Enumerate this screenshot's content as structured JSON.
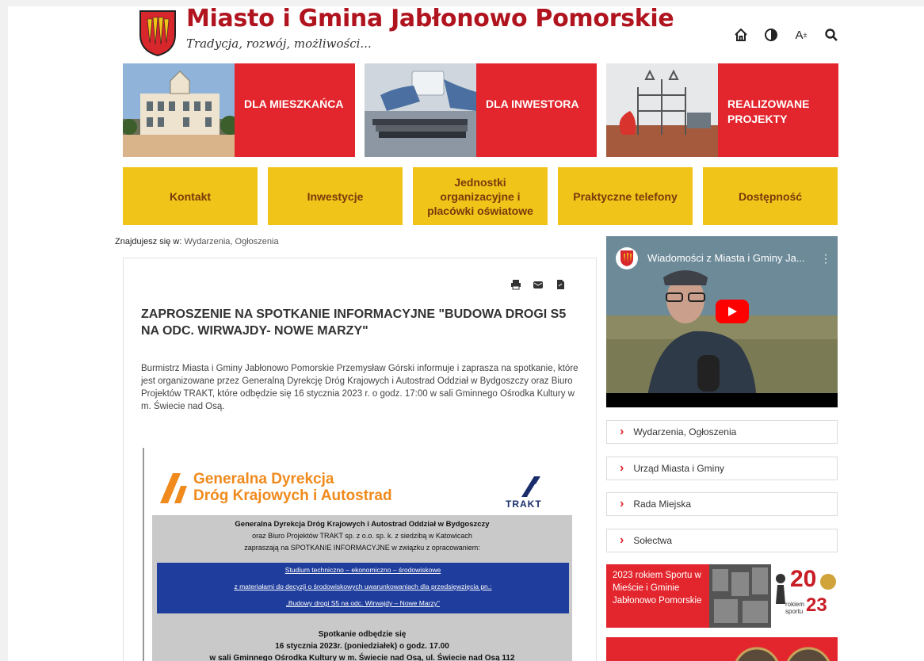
{
  "header": {
    "title": "Miasto i Gmina Jabłonowo Pomorskie",
    "subtitle": "Tradycja, rozwój, możliwości..."
  },
  "toolbar": {
    "icons": [
      "home-icon",
      "contrast-icon",
      "font-size-icon",
      "search-icon"
    ],
    "font_label": "A"
  },
  "tiles": [
    {
      "label": "DLA MIESZKAŃCA"
    },
    {
      "label": "DLA INWESTORA"
    },
    {
      "label": "REALIZOWANE PROJEKTY"
    }
  ],
  "nav": [
    {
      "label": "Kontakt"
    },
    {
      "label": "Inwestycje"
    },
    {
      "label": "Jednostki organizacyjne i placówki oświatowe"
    },
    {
      "label": "Praktyczne telefony"
    },
    {
      "label": "Dostępność"
    }
  ],
  "breadcrumb": {
    "prefix": "Znajdujesz się w:",
    "path": "Wydarzenia, Ogłoszenia"
  },
  "article": {
    "title": "ZAPROSZENIE NA SPOTKANIE INFORMACYJNE \"BUDOWA DROGI S5 NA ODC. WIRWAJDY- NOWE MARZY\"",
    "body": "Burmistrz Miasta i Gminy Jabłonowo Pomorskie Przemysław Górski informuje i zaprasza na spotkanie, które jest organizowane przez Generalną Dyrekcję Dróg Krajowych i Autostrad Oddział w Bydgoszczy oraz Biuro Projektów TRAKT, które odbędzie się 16 stycznia 2023 r. o godz. 17:00 w sali Gminnego Ośrodka Kultury w m. Świecie nad Osą."
  },
  "poster": {
    "org_line1": "Generalna Dyrekcja",
    "org_line2": "Dróg Krajowych i Autostrad",
    "trakt": "TRAKT",
    "line1": "Generalna Dyrekcja Dróg Krajowych i Autostrad  Oddział w Bydgoszczy",
    "line2": "oraz Biuro Projektów TRAKT sp. z o.o. sp. k. z siedzibą w Katowicach",
    "line3": "zapraszają na SPOTKANIE INFORMACYJNE w związku z opracowaniem:",
    "blue1": "Studium techniczno – ekonomiczno – środowiskowe",
    "blue2": "z materiałami do decyzji o środowiskowych uwarunkowaniach  dla przedsięwzięcia pn.:",
    "blue3": "„Budowy drogi S5  na odc. Wirwajdy – Nowe Marzy\"",
    "meet1": "Spotkanie odbędzie się",
    "meet2": "16 stycznia 2023r. (poniedziałek) o godz. 17.00",
    "meet3": "w sali Gminnego Ośrodka Kultury w m. Świecie nad Osą, ul. Świecie nad Osą 112"
  },
  "video": {
    "title": "Wiadomości z Miasta i Gminy Ja..."
  },
  "side_menu": [
    {
      "label": "Wydarzenia, Ogłoszenia"
    },
    {
      "label": "Urząd Miasta i Gminy"
    },
    {
      "label": "Rada Miejska"
    },
    {
      "label": "Sołectwa"
    }
  ],
  "banner": {
    "text": "2023 rokiem Sportu w Mieście i Gminie Jabłonowo Pomorskie",
    "badge_num_left": "20",
    "badge_num_right": "23",
    "badge_caption": "rokiem sportu"
  },
  "colors": {
    "brand_red": "#e3262d",
    "title_red": "#b0141f",
    "nav_yellow": "#f0c419",
    "nav_text": "#7a3a0c"
  }
}
